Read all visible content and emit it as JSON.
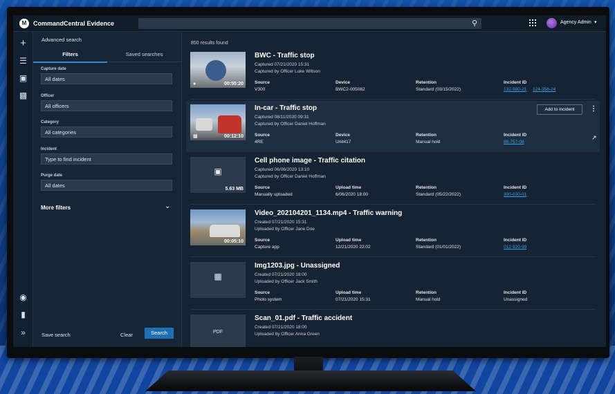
{
  "app": {
    "title": "CommandCentral Evidence",
    "user": "Agency Admin"
  },
  "filters": {
    "heading": "Advanced search",
    "tabs": [
      "Filters",
      "Saved searches"
    ],
    "fields": [
      {
        "label": "Capture date",
        "value": "All dates"
      },
      {
        "label": "Officer",
        "value": "All officers"
      },
      {
        "label": "Category",
        "value": "All categories"
      },
      {
        "label": "Incident",
        "value": "Type to find incident"
      },
      {
        "label": "Purge date",
        "value": "All dates"
      }
    ],
    "more_filters": "More filters",
    "save_search": "Save search",
    "clear": "Clear",
    "search": "Search"
  },
  "results": {
    "count": "850 results found",
    "add_to_incident": "Add to incident",
    "items": [
      {
        "title": "BWC - Traffic stop",
        "line1": "Captured 07/21/2020 15:31",
        "line2": "Captured by Officer Luke Willson",
        "duration": "00:55:20",
        "col1_label": "Source",
        "col1_value": "V300",
        "col2_label": "Device",
        "col2_value": "BWC2-005062",
        "col3_label": "Retention",
        "col3_value": "Standard (03/15/2022)",
        "col4_label": "Incident ID",
        "col4_value": "132-980-21",
        "col4_value_extra": "124-356-24"
      },
      {
        "title": "In-car - Traffic stop",
        "line1": "Captured 08/11/2020 09:31",
        "line2": "Captured by Officer Daniel Hoffman",
        "duration": "00:12:10",
        "col1_label": "Source",
        "col1_value": "4RE",
        "col2_label": "Device",
        "col2_value": "Unit417",
        "col3_label": "Retention",
        "col3_value": "Manual hold",
        "col4_label": "Incident ID",
        "col4_value": "88-757-08"
      },
      {
        "title": "Cell phone image - Traffic citation",
        "line1": "Captured 06/06/2020 13:10",
        "line2": "Captured by Officer Daniel Hoffman",
        "duration": "5.63 MB",
        "col1_label": "Source",
        "col1_value": "Manually uploaded",
        "col2_label": "Upload time",
        "col2_value": "6/06/2020 18:00",
        "col3_label": "Retention",
        "col3_value": "Standard (05/22/2022)",
        "col4_label": "Incident ID",
        "col4_value": "300-030-01"
      },
      {
        "title": "Video_202104201_1134.mp4 - Traffic warning",
        "line1": "Created 07/21/2020 15:31",
        "line2": "Uploaded by Officer Jane Doe",
        "duration": "00:05:10",
        "col1_label": "Source",
        "col1_value": "Capture app",
        "col2_label": "Upload time",
        "col2_value": "12/21/2020 22:02",
        "col3_label": "Retention",
        "col3_value": "Standard (01/01/2022)",
        "col4_label": "Incident ID",
        "col4_value": "012-920-99"
      },
      {
        "title": "Img1203.jpg - Unassigned",
        "line1": "Created 07/21/2020 18:00",
        "line2": "Uploaded by Officer Jack Smith",
        "col1_label": "Source",
        "col1_value": "Photo system",
        "col2_label": "Upload time",
        "col2_value": "07/21/2020 15:31",
        "col3_label": "Retention",
        "col3_value": "Manual hold",
        "col4_label": "Incident ID",
        "col4_value": "Unassigned"
      },
      {
        "title": "Scan_01.pdf - Traffic accident",
        "line1": "Created 07/21/2020 18:00",
        "line2": "Uploaded by Officer Anna Green",
        "file_badge": "PDF"
      }
    ]
  },
  "icons": {
    "logo": "motorola-logo-icon",
    "search": "search-icon",
    "apps": "apps-grid-icon",
    "rail": [
      "plus-icon",
      "evidence-icon",
      "cases-icon",
      "monitor-icon",
      "globe-icon",
      "chart-icon",
      "expand-icon"
    ]
  }
}
